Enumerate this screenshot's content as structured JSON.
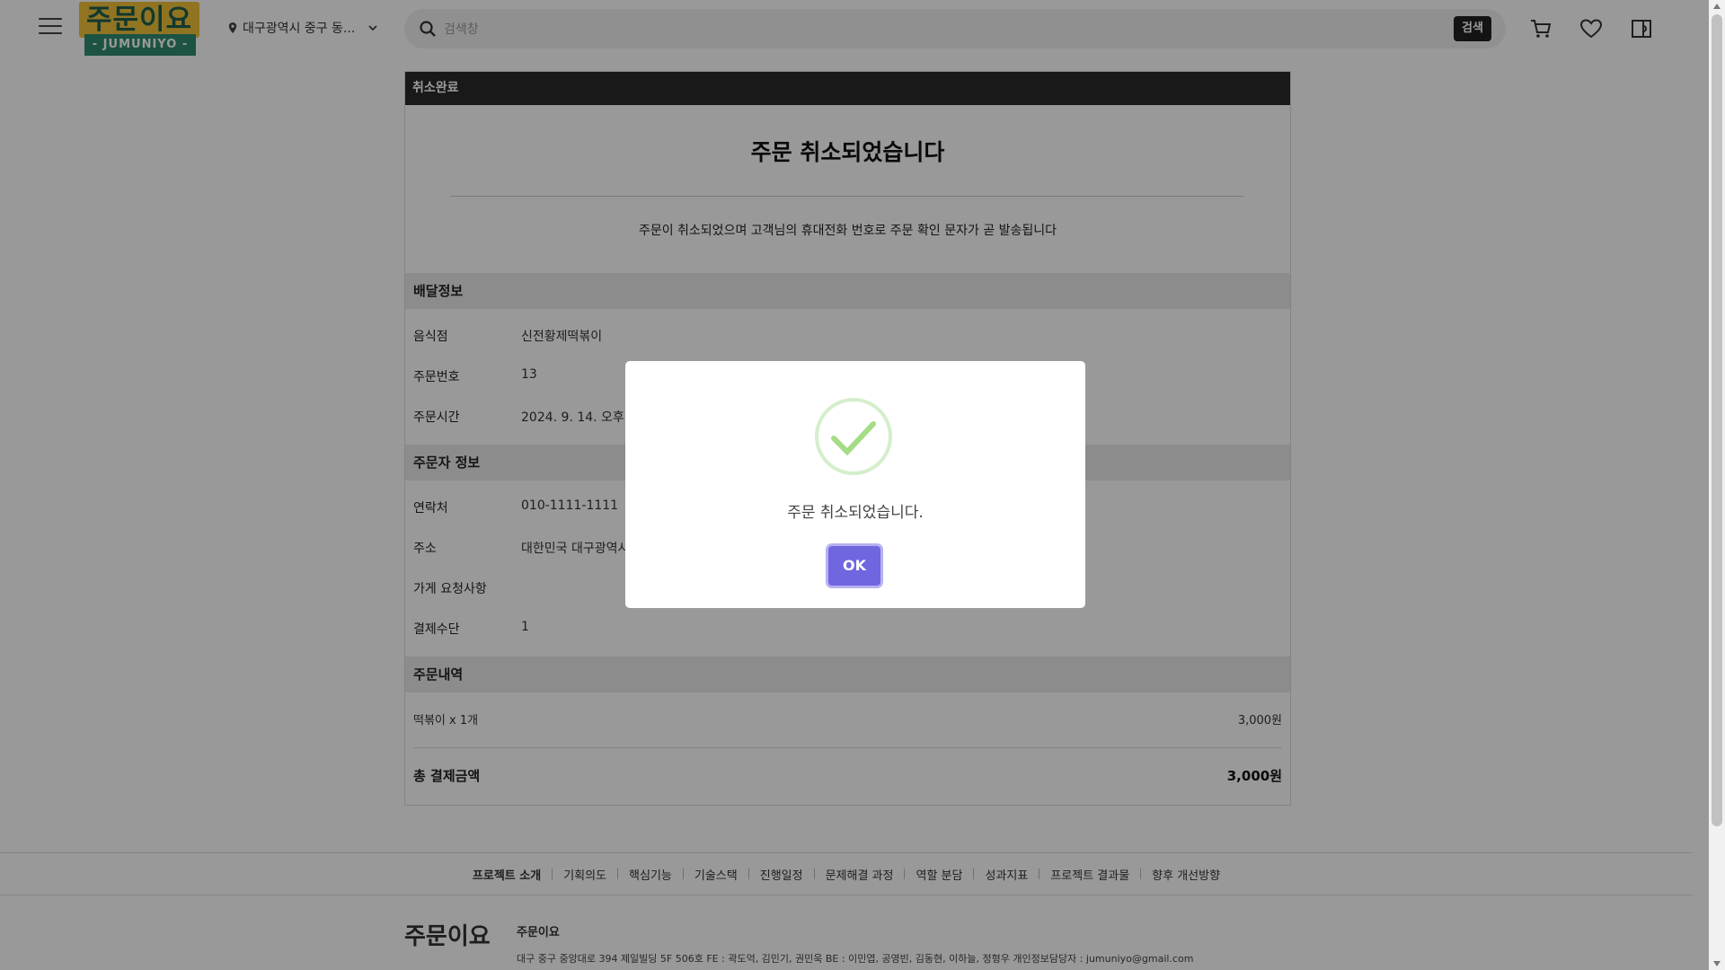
{
  "header": {
    "location": "대구광역시 중구 동...",
    "search_placeholder": "검색창",
    "search_button": "검색",
    "logo_top": "주문이요",
    "logo_bottom": "- JUMUNIYO -"
  },
  "card": {
    "head": "취소완료",
    "title": "주문 취소되었습니다",
    "notice": "주문이 취소되었으며 고객님의 휴대전화 번호로 주문 확인 문자가 곧 발송됩니다"
  },
  "delivery": {
    "heading": "배달정보",
    "rows": [
      {
        "label": "음식점",
        "value": "신전황제떡볶이"
      },
      {
        "label": "주문번호",
        "value": "13"
      },
      {
        "label": "주문시간",
        "value": "2024. 9. 14. 오후 1("
      }
    ]
  },
  "customer": {
    "heading": "주문자 정보",
    "rows": [
      {
        "label": "연락처",
        "value": "010-1111-1111"
      },
      {
        "label": "주소",
        "value": "대한민국 대구광역시"
      },
      {
        "label": "가게 요청사항",
        "value": ""
      },
      {
        "label": "결제수단",
        "value": "1"
      }
    ]
  },
  "order": {
    "heading": "주문내역",
    "items": [
      {
        "name": "떡볶이 x 1개",
        "price": "3,000원"
      }
    ],
    "total_label": "총 결제금액",
    "total_price": "3,000원"
  },
  "footer": {
    "nav": [
      "프로젝트 소개",
      "기획의도",
      "핵심기능",
      "기술스택",
      "진행일정",
      "문제해결 과정",
      "역할 분담",
      "성과지표",
      "프로젝트 결과물",
      "향후 개선방향"
    ],
    "logo": "주문이요",
    "name": "주문이요",
    "info": "대구 중구 중앙대로 394 제일빌딩 5F 506호    FE : 곽도억, 김민기, 권민욱    BE : 이민엽, 공영빈, 김동현, 이하늘, 정형우    개인정보담당자 : jumuniyo@gmail.com"
  },
  "modal": {
    "message": "주문 취소되었습니다.",
    "ok": "OK"
  },
  "colors": {
    "accent": "#7066e0",
    "success": "#a5dc86",
    "header_bar": "#2a2a2a",
    "logo_yellow": "#f0c23a",
    "logo_green": "#2f8a6e"
  },
  "icons": [
    "menu-icon",
    "location-pin-icon",
    "chevron-down-icon",
    "search-icon",
    "cart-icon",
    "heart-icon",
    "coupon-icon",
    "check-icon"
  ]
}
